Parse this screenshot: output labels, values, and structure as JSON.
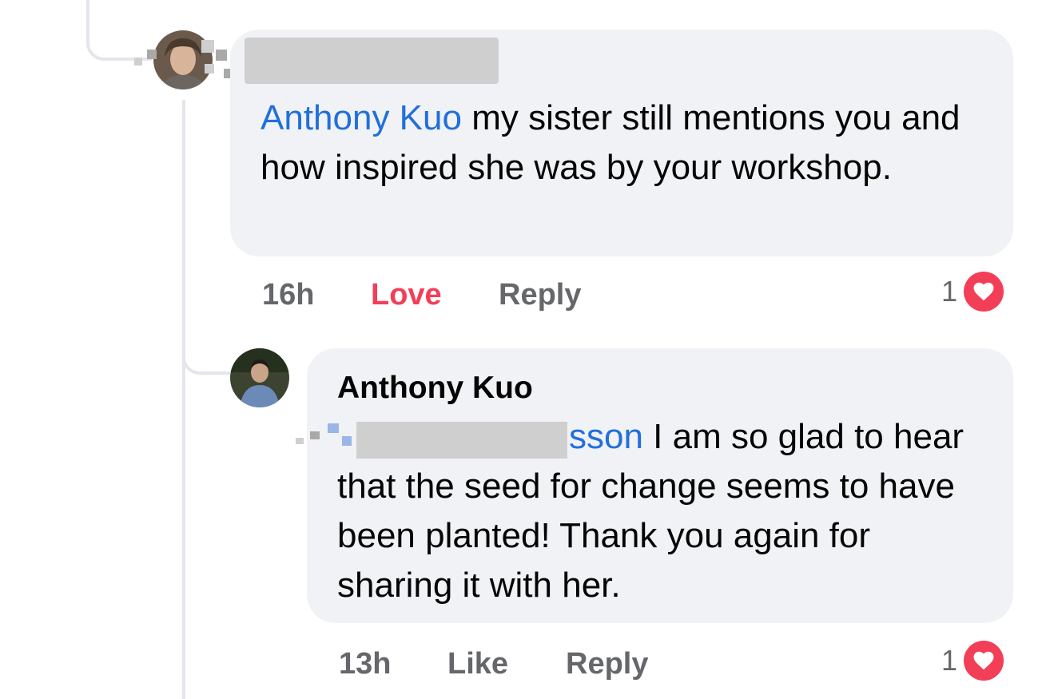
{
  "comment_1": {
    "mention": "Anthony Kuo",
    "text": " my sister still mentions you and how inspired she was by your workshop.",
    "timestamp": "16h",
    "react_label": "Love",
    "reply_label": "Reply",
    "reaction_count": "1"
  },
  "comment_2": {
    "author": "Anthony Kuo",
    "mention_visible": "sson",
    "text": " I am so glad to hear that the seed for change seems to have been planted! Thank you again for sharing it with her.",
    "timestamp": "13h",
    "react_label": "Like",
    "reply_label": "Reply",
    "reaction_count": "1"
  },
  "colors": {
    "bubble": "#f0f2f5",
    "mention": "#216fdb",
    "love": "#f33e58",
    "meta": "#65676b"
  },
  "icons": {
    "reaction": "heart-icon"
  }
}
